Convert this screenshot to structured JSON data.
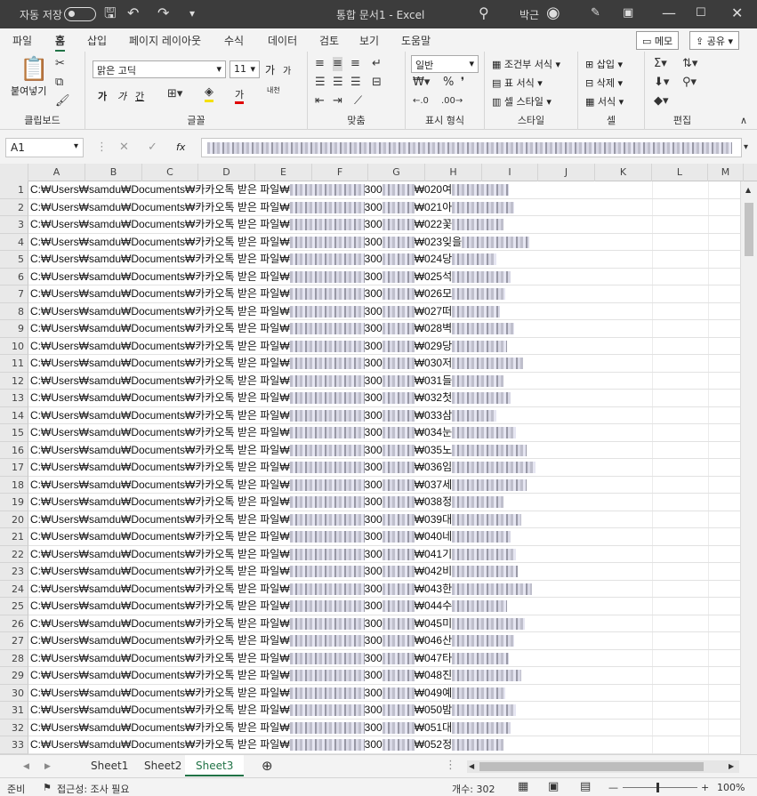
{
  "title_bar": {
    "autosave_label": "자동 저장",
    "autosave_state": "off",
    "document_title": "통합 문서1 - Excel",
    "user_name": "박근"
  },
  "tabs": [
    "파일",
    "홈",
    "삽입",
    "페이지 레이아웃",
    "수식",
    "데이터",
    "검토",
    "보기",
    "도움말"
  ],
  "active_tab": "홈",
  "top_buttons": {
    "memo": "메모",
    "share": "공유"
  },
  "ribbon": {
    "clipboard": {
      "label": "클립보드",
      "paste": "붙여넣기"
    },
    "font": {
      "label": "글꼴",
      "font_name": "맑은 고딕",
      "font_size": "11",
      "bold": "가",
      "italic": "가",
      "underline": "간",
      "grow": "가",
      "shrink": "가",
      "color_label": "가",
      "phonetic": "내천"
    },
    "alignment": {
      "label": "맞춤"
    },
    "number": {
      "label": "표시 형식",
      "format": "일반"
    },
    "styles": {
      "label": "스타일",
      "conditional": "조건부 서식",
      "table": "표 서식",
      "cell": "셀 스타일"
    },
    "cells": {
      "label": "셀",
      "insert": "삽입",
      "delete": "삭제",
      "format": "서식"
    },
    "editing": {
      "label": "편집"
    }
  },
  "formula_bar": {
    "name_box": "A1",
    "fx": "fx"
  },
  "columns": [
    "A",
    "B",
    "C",
    "D",
    "E",
    "F",
    "G",
    "H",
    "I",
    "J",
    "K",
    "L",
    "M"
  ],
  "cell_prefix": "C:₩Users₩samdu₩Documents₩카카오톡 받은 파일₩",
  "rows": [
    {
      "n": "1",
      "mid": "300",
      "code": "020",
      "tail": "여"
    },
    {
      "n": "2",
      "mid": "300",
      "code": "021",
      "tail": "아"
    },
    {
      "n": "3",
      "mid": "300",
      "code": "022",
      "tail": "꽃"
    },
    {
      "n": "4",
      "mid": "300",
      "code": "023",
      "tail": "잊을"
    },
    {
      "n": "5",
      "mid": "300",
      "code": "024",
      "tail": "당"
    },
    {
      "n": "6",
      "mid": "300",
      "code": "025",
      "tail": "석"
    },
    {
      "n": "7",
      "mid": "300",
      "code": "026",
      "tail": "모"
    },
    {
      "n": "8",
      "mid": "300",
      "code": "027",
      "tail": "떠"
    },
    {
      "n": "9",
      "mid": "300",
      "code": "028",
      "tail": "벽"
    },
    {
      "n": "10",
      "mid": "300",
      "code": "029",
      "tail": "당"
    },
    {
      "n": "11",
      "mid": "300",
      "code": "030",
      "tail": "저"
    },
    {
      "n": "12",
      "mid": "300",
      "code": "031",
      "tail": "들"
    },
    {
      "n": "13",
      "mid": "300",
      "code": "032",
      "tail": "첫"
    },
    {
      "n": "14",
      "mid": "300",
      "code": "033",
      "tail": "삼"
    },
    {
      "n": "15",
      "mid": "300",
      "code": "034",
      "tail": "눈"
    },
    {
      "n": "16",
      "mid": "300",
      "code": "035",
      "tail": "노"
    },
    {
      "n": "17",
      "mid": "300",
      "code": "036",
      "tail": "임"
    },
    {
      "n": "18",
      "mid": "300",
      "code": "037",
      "tail": "세"
    },
    {
      "n": "19",
      "mid": "300",
      "code": "038",
      "tail": "정"
    },
    {
      "n": "20",
      "mid": "300",
      "code": "039",
      "tail": "대"
    },
    {
      "n": "21",
      "mid": "300",
      "code": "040",
      "tail": "네"
    },
    {
      "n": "22",
      "mid": "300",
      "code": "041",
      "tail": "기"
    },
    {
      "n": "23",
      "mid": "300",
      "code": "042",
      "tail": "비"
    },
    {
      "n": "24",
      "mid": "300",
      "code": "043",
      "tail": "한"
    },
    {
      "n": "25",
      "mid": "300",
      "code": "044",
      "tail": "수"
    },
    {
      "n": "26",
      "mid": "300",
      "code": "045",
      "tail": "미"
    },
    {
      "n": "27",
      "mid": "300",
      "code": "046",
      "tail": "산"
    },
    {
      "n": "28",
      "mid": "300",
      "code": "047",
      "tail": "타"
    },
    {
      "n": "29",
      "mid": "300",
      "code": "048",
      "tail": "진"
    },
    {
      "n": "30",
      "mid": "300",
      "code": "049",
      "tail": "예"
    },
    {
      "n": "31",
      "mid": "300",
      "code": "050",
      "tail": "밤"
    },
    {
      "n": "32",
      "mid": "300",
      "code": "051",
      "tail": "대"
    },
    {
      "n": "33",
      "mid": "300",
      "code": "052",
      "tail": "정"
    }
  ],
  "sheets": [
    "Sheet1",
    "Sheet2",
    "Sheet3"
  ],
  "active_sheet": "Sheet3",
  "status": {
    "ready": "준비",
    "accessibility": "접근성: 조사 필요",
    "count_label": "개수: 302",
    "zoom": "100%"
  },
  "colors": {
    "accent": "#217346",
    "titlebar": "#3c3c3c"
  }
}
